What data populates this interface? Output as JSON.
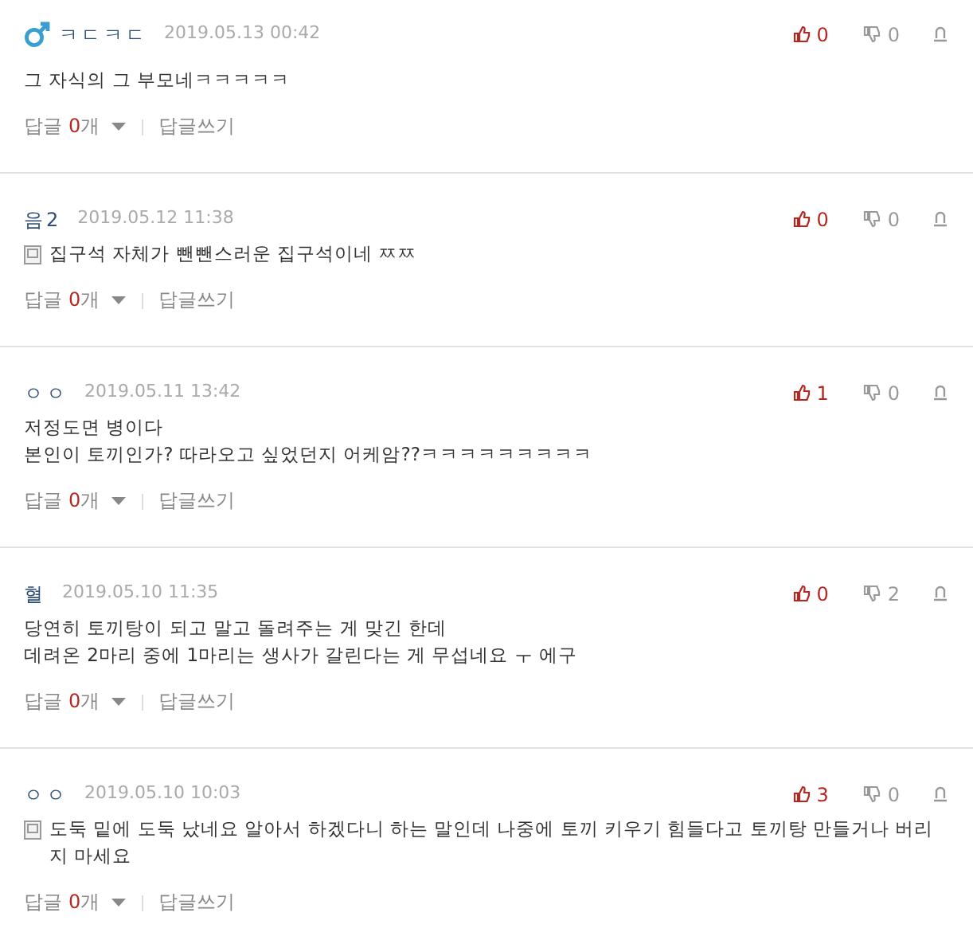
{
  "comments": [
    {
      "author": "ㅋㄷㅋㄷ",
      "male": true,
      "memo": false,
      "date": "2019.05.13 00:42",
      "lines": [
        "그 자식의 그 부모네ㅋㅋㅋㅋㅋ"
      ],
      "likes": "0",
      "dislikes": "0",
      "reply_label": "답글",
      "reply_count": "0",
      "reply_unit": "개",
      "write_label": "답글쓰기"
    },
    {
      "author": "음2",
      "memo": true,
      "date": "2019.05.12 11:38",
      "lines": [
        "집구석 자체가 뺀뺀스러운 집구석이네 ㅉㅉ"
      ],
      "likes": "0",
      "dislikes": "0",
      "reply_label": "답글",
      "reply_count": "0",
      "reply_unit": "개",
      "write_label": "답글쓰기"
    },
    {
      "author": "ㅇㅇ",
      "memo": false,
      "date": "2019.05.11 13:42",
      "lines": [
        "저정도면 병이다",
        "본인이 토끼인가? 따라오고 싶었던지 어케암??ㅋㅋㅋㅋㅋㅋㅋㅋㅋ"
      ],
      "likes": "1",
      "dislikes": "0",
      "reply_label": "답글",
      "reply_count": "0",
      "reply_unit": "개",
      "write_label": "답글쓰기"
    },
    {
      "author": "혈",
      "memo": false,
      "date": "2019.05.10 11:35",
      "lines": [
        "당연히 토끼탕이 되고 말고 돌려주는 게 맞긴 한데",
        "데려온 2마리 중에 1마리는 생사가 갈린다는 게 무섭네요 ㅜ 에구"
      ],
      "likes": "0",
      "dislikes": "2",
      "reply_label": "답글",
      "reply_count": "0",
      "reply_unit": "개",
      "write_label": "답글쓰기"
    },
    {
      "author": "ㅇㅇ",
      "memo": true,
      "date": "2019.05.10 10:03",
      "lines": [
        "도둑 밑에 도둑 났네요 알아서 하겠다니 하는 말인데 나중에 토끼 키우기 힘들다고 토끼탕 만들거나 버리",
        "지 마세요"
      ],
      "likes": "3",
      "dislikes": "0",
      "reply_label": "답글",
      "reply_count": "0",
      "reply_unit": "개",
      "write_label": "답글쓰기"
    }
  ]
}
